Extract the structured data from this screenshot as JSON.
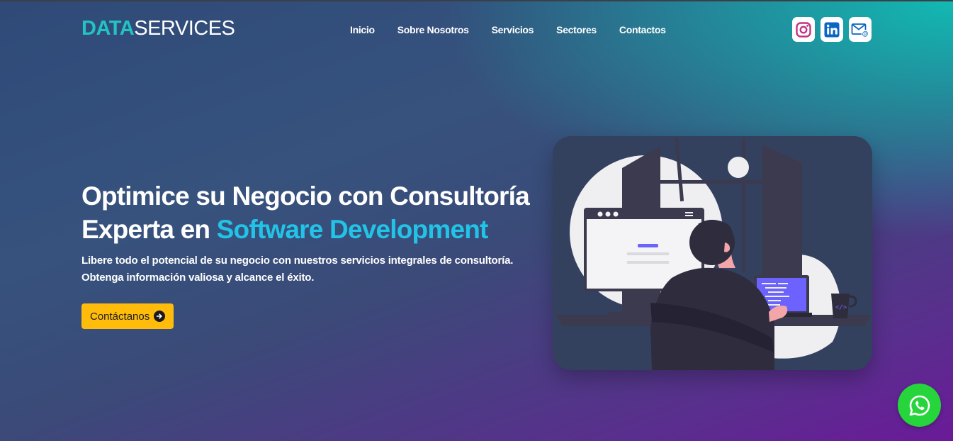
{
  "brand": {
    "part1": "DATA",
    "part2": "SERVICES"
  },
  "nav": {
    "items": [
      "Inicio",
      "Sobre Nosotros",
      "Servicios",
      "Sectores",
      "Contactos"
    ]
  },
  "social": [
    {
      "icon": "instagram-icon",
      "color": "#c13584"
    },
    {
      "icon": "linkedin-icon",
      "color": "#0a66c2"
    },
    {
      "icon": "email-icon",
      "color": "#0a66c2"
    }
  ],
  "hero": {
    "title_line1": "Optimice su Negocio con Consultoría",
    "title_line2_prefix": "Experta en ",
    "title_highlight": "Software Development",
    "description": "Libere todo el potencial de su negocio con nuestros servicios integrales de consultoría. Obtenga información valiosa y alcance el éxito.",
    "cta_label": "Contáctanos"
  },
  "colors": {
    "accent_teal": "#22c3c0",
    "highlight_blue": "#21c4e6",
    "cta_yellow": "#ffbc0a",
    "whatsapp_green": "#26d43b",
    "illustration_purple": "#6c63ff"
  }
}
